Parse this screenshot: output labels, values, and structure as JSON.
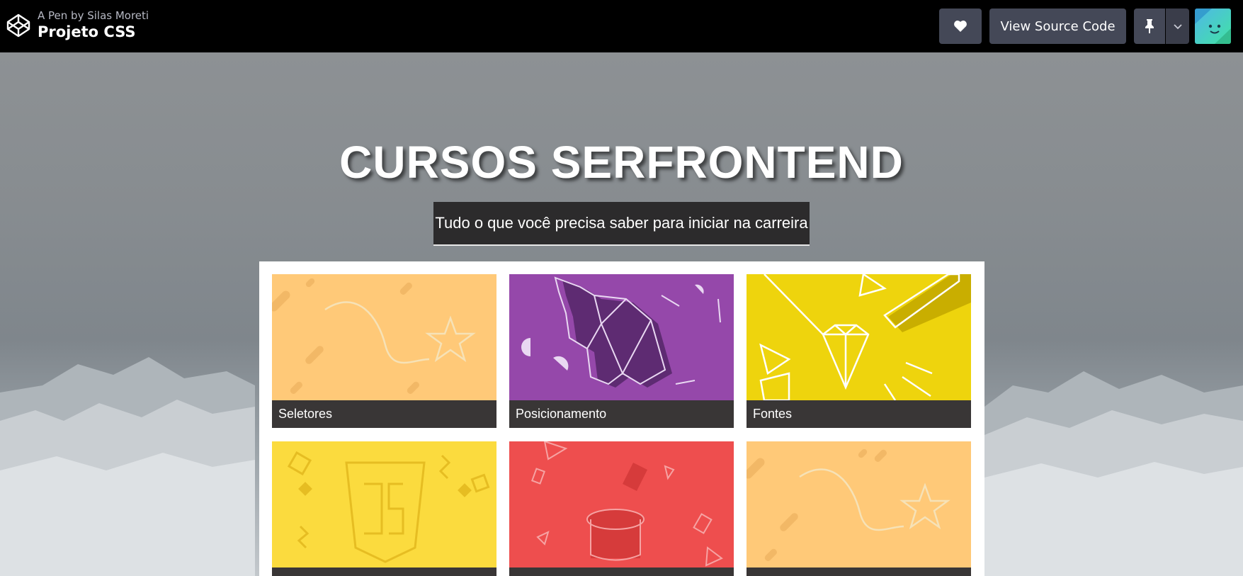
{
  "header": {
    "byline": "A Pen by Silas Moreti",
    "title": "Projeto CSS",
    "source_button": "View Source Code",
    "icons": [
      "codepen-logo-icon",
      "heart-icon",
      "pin-icon",
      "chevron-down-icon",
      "avatar"
    ]
  },
  "hero": {
    "title": "CURSOS SERFRONTEND",
    "subtitle": "Tudo o que você precisa saber para iniciar na carreira"
  },
  "courses": [
    {
      "label": "Seletores",
      "color": "#ffc978"
    },
    {
      "label": "Posicionamento",
      "color": "#9548aa"
    },
    {
      "label": "Fontes",
      "color": "#eed40d"
    },
    {
      "label": "",
      "color": "#fbdb3e"
    },
    {
      "label": "",
      "color": "#ee4e4e"
    },
    {
      "label": "",
      "color": "#ffc978"
    }
  ]
}
